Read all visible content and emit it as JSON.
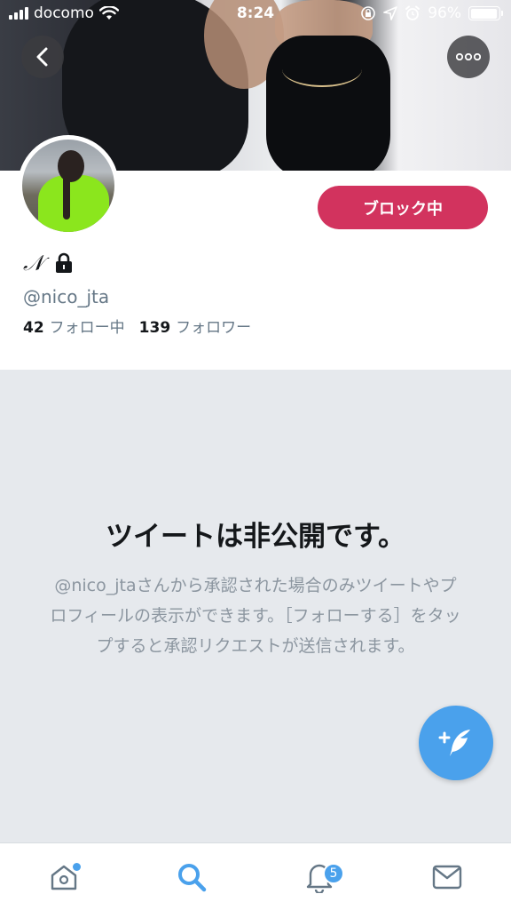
{
  "status_bar": {
    "carrier": "docomo",
    "time": "8:24",
    "battery": "96%",
    "battery_level": 0.96
  },
  "profile": {
    "display_name": "𝒩",
    "username": "@nico_jta",
    "following_count": "42",
    "following_label": "フォロー中",
    "followers_count": "139",
    "followers_label": "フォロワー",
    "block_button_label": "ブロック中"
  },
  "protected": {
    "title": "ツイートは非公開です。",
    "description": "@nico_jtaさんから承認された場合のみツイートやプロフィールの表示ができます。［フォローする］をタップすると承認リクエストが送信されます。"
  },
  "tab_bar": {
    "notifications_badge": "5"
  },
  "colors": {
    "accent": "#4aa1ec",
    "block": "#d2335e",
    "panel": "#e6e9ed"
  }
}
